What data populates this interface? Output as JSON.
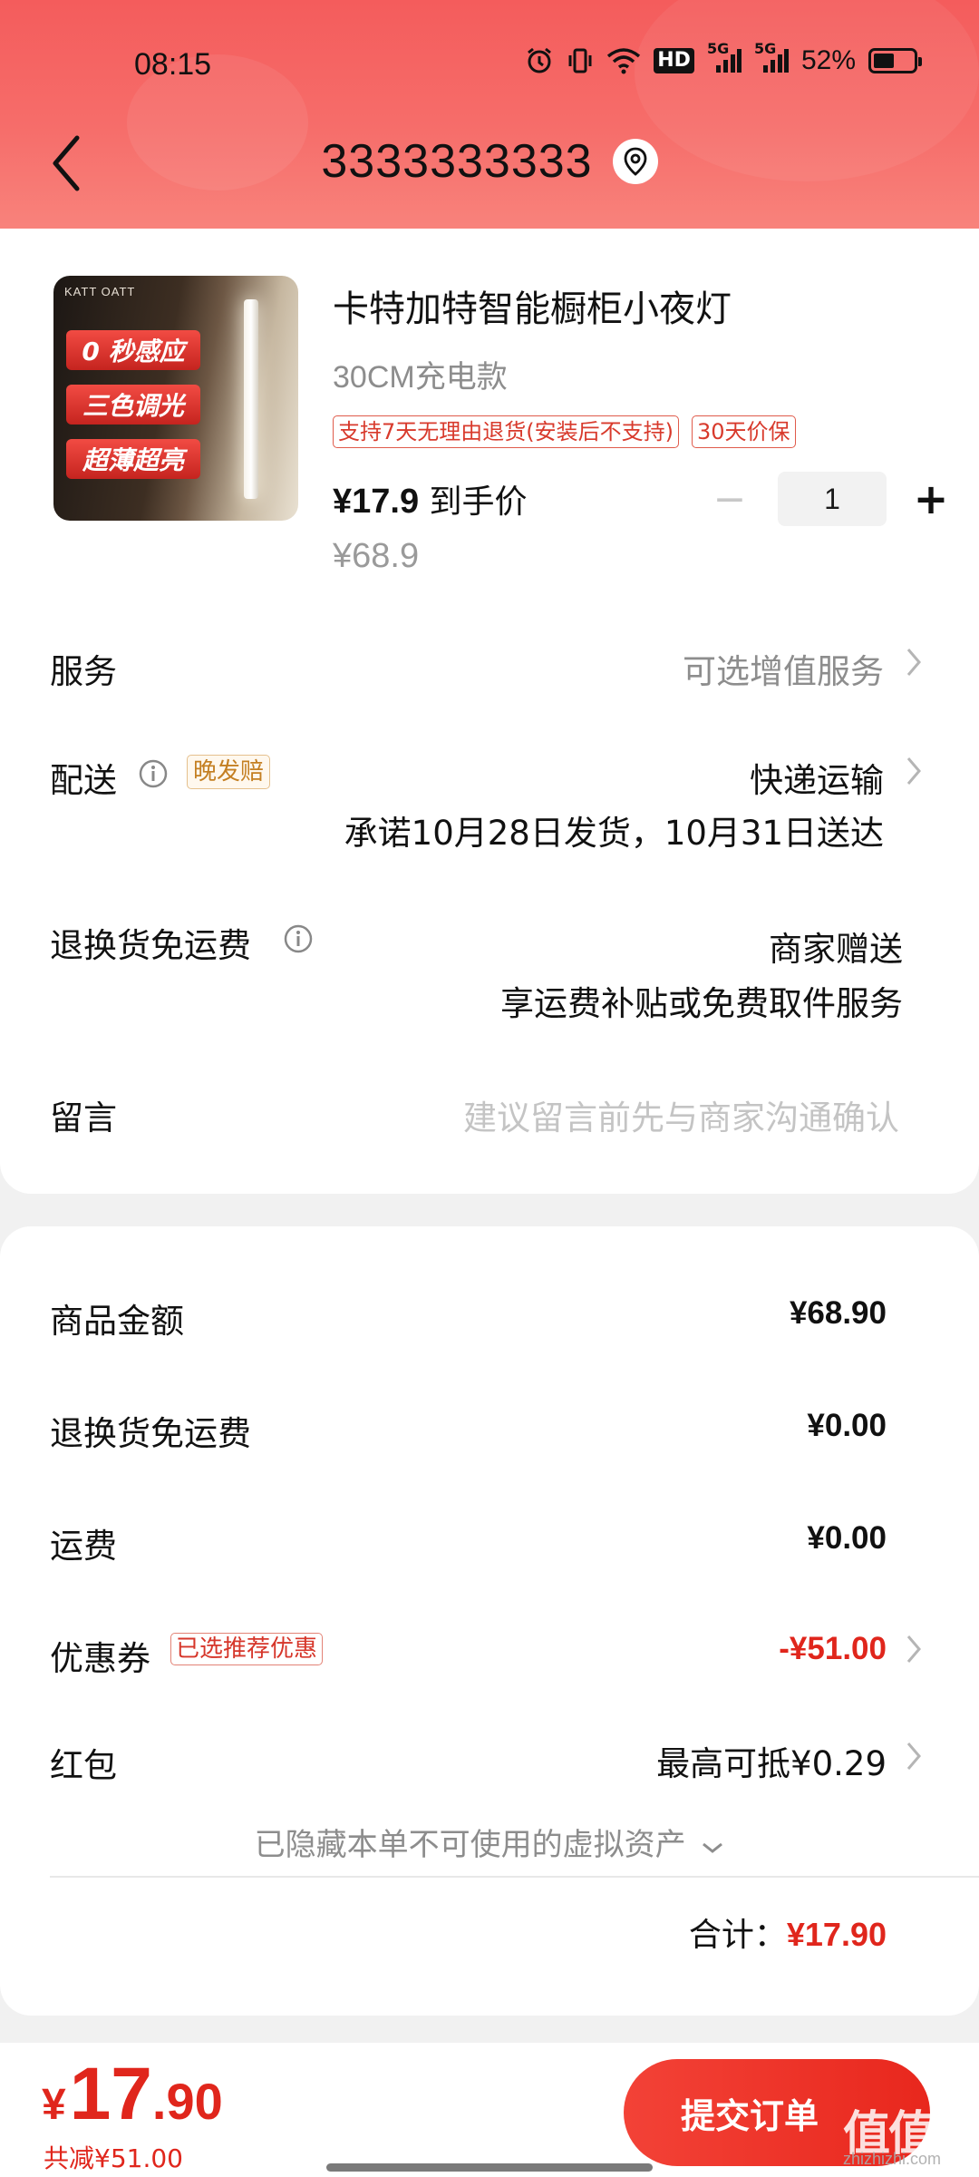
{
  "status_bar": {
    "time": "08:15",
    "battery_percent": "52%",
    "battery_level": 0.52,
    "icons": [
      "alarm-icon",
      "vibrate-icon",
      "wifi-icon",
      "hd-icon",
      "signal-5g-icon",
      "signal-5g-icon",
      "battery-icon"
    ],
    "hd_label": "HD",
    "net1": "5G",
    "net2": "5G"
  },
  "header": {
    "title": "3333333333",
    "back_icon": "chevron-left-icon",
    "location_icon": "location-pin-icon",
    "gradient": [
      "#f45c5c",
      "#f8837c"
    ]
  },
  "product": {
    "image_brand": "KATT OATT",
    "image_tags": [
      "0 秒感应",
      "三色调光",
      "超薄超亮"
    ],
    "title": "卡特加特智能橱柜小夜灯",
    "spec": "30CM充电款",
    "tags": [
      "支持7天无理由退货(安装后不支持)",
      "30天价保"
    ],
    "price": "¥17.9",
    "price_suffix": " 到手价",
    "original_price": "¥68.9",
    "quantity": "1",
    "minus_label": "−",
    "plus_label": "+"
  },
  "rows": {
    "service": {
      "label": "服务",
      "value": "可选增值服务"
    },
    "delivery": {
      "label": "配送",
      "badge": "晚发赔",
      "method": "快递运输",
      "promise": "承诺10月28日发货，10月31日送达"
    },
    "return_shipping": {
      "label": "退换货免运费",
      "value": "商家赠送",
      "sub": "享运费补贴或免费取件服务"
    },
    "message": {
      "label": "留言",
      "placeholder": "建议留言前先与商家沟通确认"
    }
  },
  "summary": {
    "goods_amount": {
      "label": "商品金额",
      "value": "¥68.90"
    },
    "return_fee": {
      "label": "退换货免运费",
      "value": "¥0.00"
    },
    "shipping": {
      "label": "运费",
      "value": "¥0.00"
    },
    "coupon": {
      "label": "优惠券",
      "badge": "已选推荐优惠",
      "value": "-¥51.00"
    },
    "red_packet": {
      "label": "红包",
      "value": "最高可抵¥0.29"
    },
    "hidden_note": "已隐藏本单不可使用的虚拟资产",
    "total_label": "合计：",
    "total_value": "¥17.90"
  },
  "bottom": {
    "currency": "¥",
    "price_int": "17",
    "price_dec": ".90",
    "reduction": "共减¥51.00",
    "submit_label": "提交订单"
  },
  "watermark": {
    "text": "值值值",
    "sub": "zhizhizhi.com"
  },
  "colors": {
    "accent_red": "#e0261c",
    "tag_red": "#d83a2c",
    "badge_gold": "#c47f22",
    "muted_gray": "#8d8d8d"
  }
}
